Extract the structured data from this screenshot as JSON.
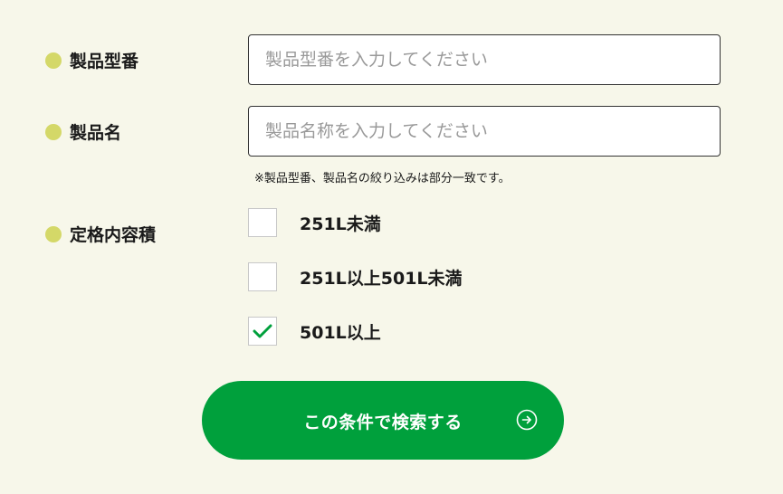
{
  "fields": {
    "model_number": {
      "label": "製品型番",
      "placeholder": "製品型番を入力してください",
      "value": ""
    },
    "product_name": {
      "label": "製品名",
      "placeholder": "製品名称を入力してください",
      "value": ""
    },
    "note": "※製品型番、製品名の絞り込みは部分一致です。"
  },
  "capacity": {
    "label": "定格内容積",
    "options": [
      {
        "label": "251L未満",
        "checked": false
      },
      {
        "label": "251L以上501L未満",
        "checked": false
      },
      {
        "label": "501L以上",
        "checked": true
      }
    ]
  },
  "submit": {
    "label": "この条件で検索する",
    "icon": "arrow-right-circle-icon"
  },
  "colors": {
    "background": "#f7f7ea",
    "bullet": "#d4d868",
    "accent": "#00a03c",
    "check": "#00a03c"
  }
}
